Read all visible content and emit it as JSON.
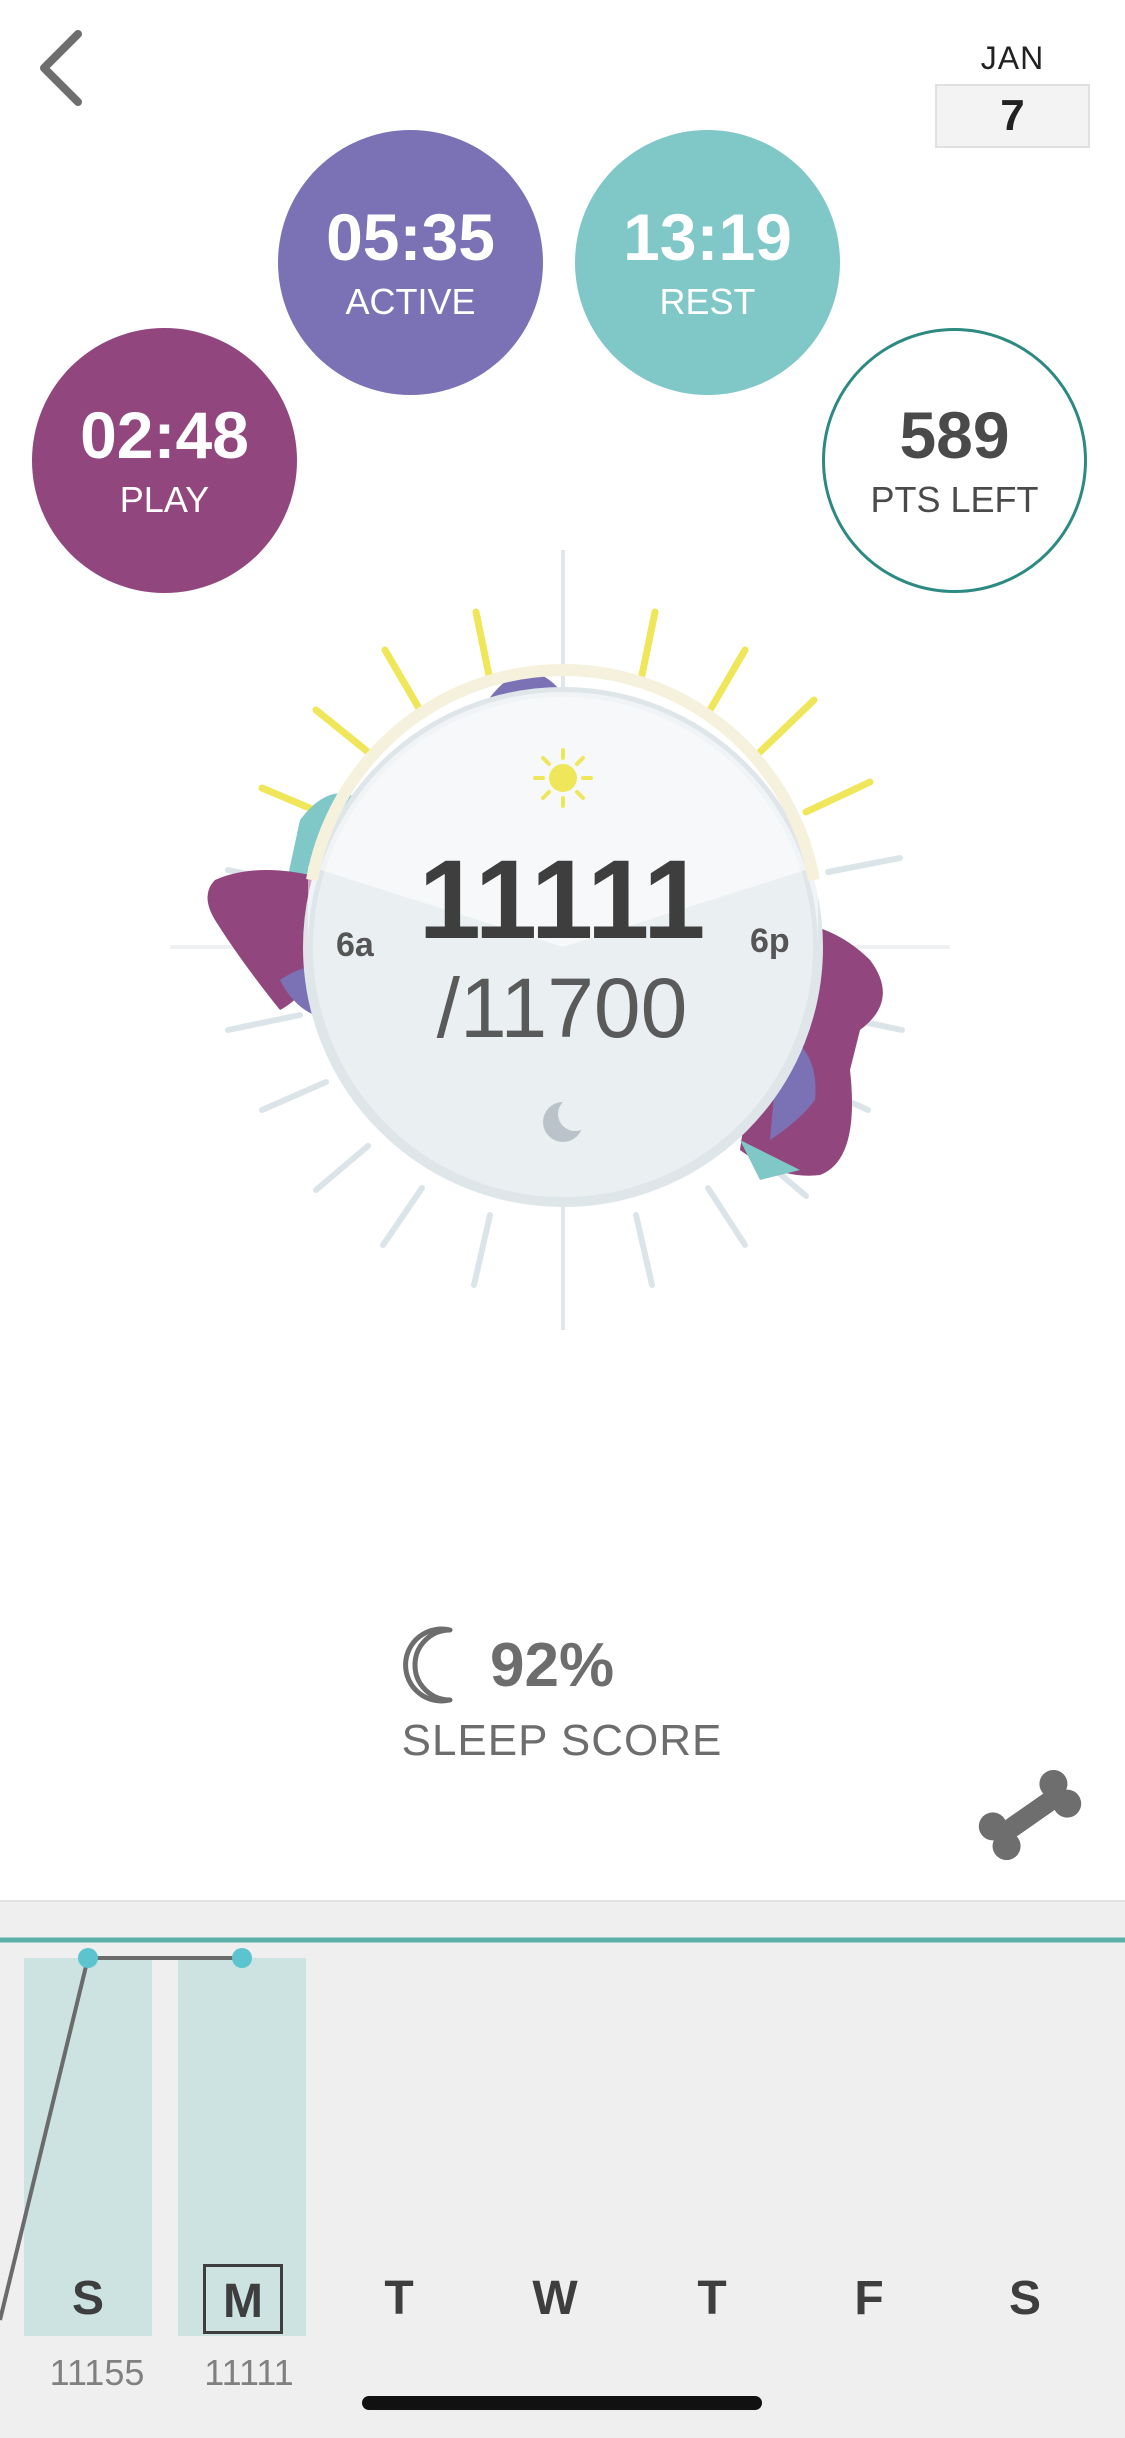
{
  "header": {
    "month": "JAN",
    "day": "7"
  },
  "stats": {
    "active": {
      "value": "05:35",
      "label": "ACTIVE"
    },
    "rest": {
      "value": "13:19",
      "label": "REST"
    },
    "play": {
      "value": "02:48",
      "label": "PLAY"
    },
    "points": {
      "value": "589",
      "label": "PTS LEFT"
    }
  },
  "dial": {
    "steps": "11111",
    "goal": "/11700",
    "label_morning": "6a",
    "label_evening": "6p",
    "icons": [
      "sun-icon",
      "moon-icon"
    ]
  },
  "sleep": {
    "score": "92%",
    "label": "SLEEP SCORE",
    "icon": "crescent-moon-icon"
  },
  "week": {
    "days": [
      {
        "letter": "S",
        "steps": "11155",
        "has_data": true,
        "selected": false
      },
      {
        "letter": "M",
        "steps": "11111",
        "has_data": true,
        "selected": true
      },
      {
        "letter": "T",
        "steps": "",
        "has_data": false,
        "selected": false
      },
      {
        "letter": "W",
        "steps": "",
        "has_data": false,
        "selected": false
      },
      {
        "letter": "T",
        "steps": "",
        "has_data": false,
        "selected": false
      },
      {
        "letter": "F",
        "steps": "",
        "has_data": false,
        "selected": false
      },
      {
        "letter": "S",
        "steps": "",
        "has_data": false,
        "selected": false
      }
    ]
  },
  "colors": {
    "active": "#7b72b6",
    "rest": "#80c7c8",
    "play": "#92467e",
    "points_ring": "#2d8a82",
    "goal_line": "#5aafa8",
    "sun": "#f0e65a",
    "day_bar": "#cde3e1"
  },
  "icons": {
    "back": "chevron-left-icon",
    "treat": "bone-icon"
  }
}
